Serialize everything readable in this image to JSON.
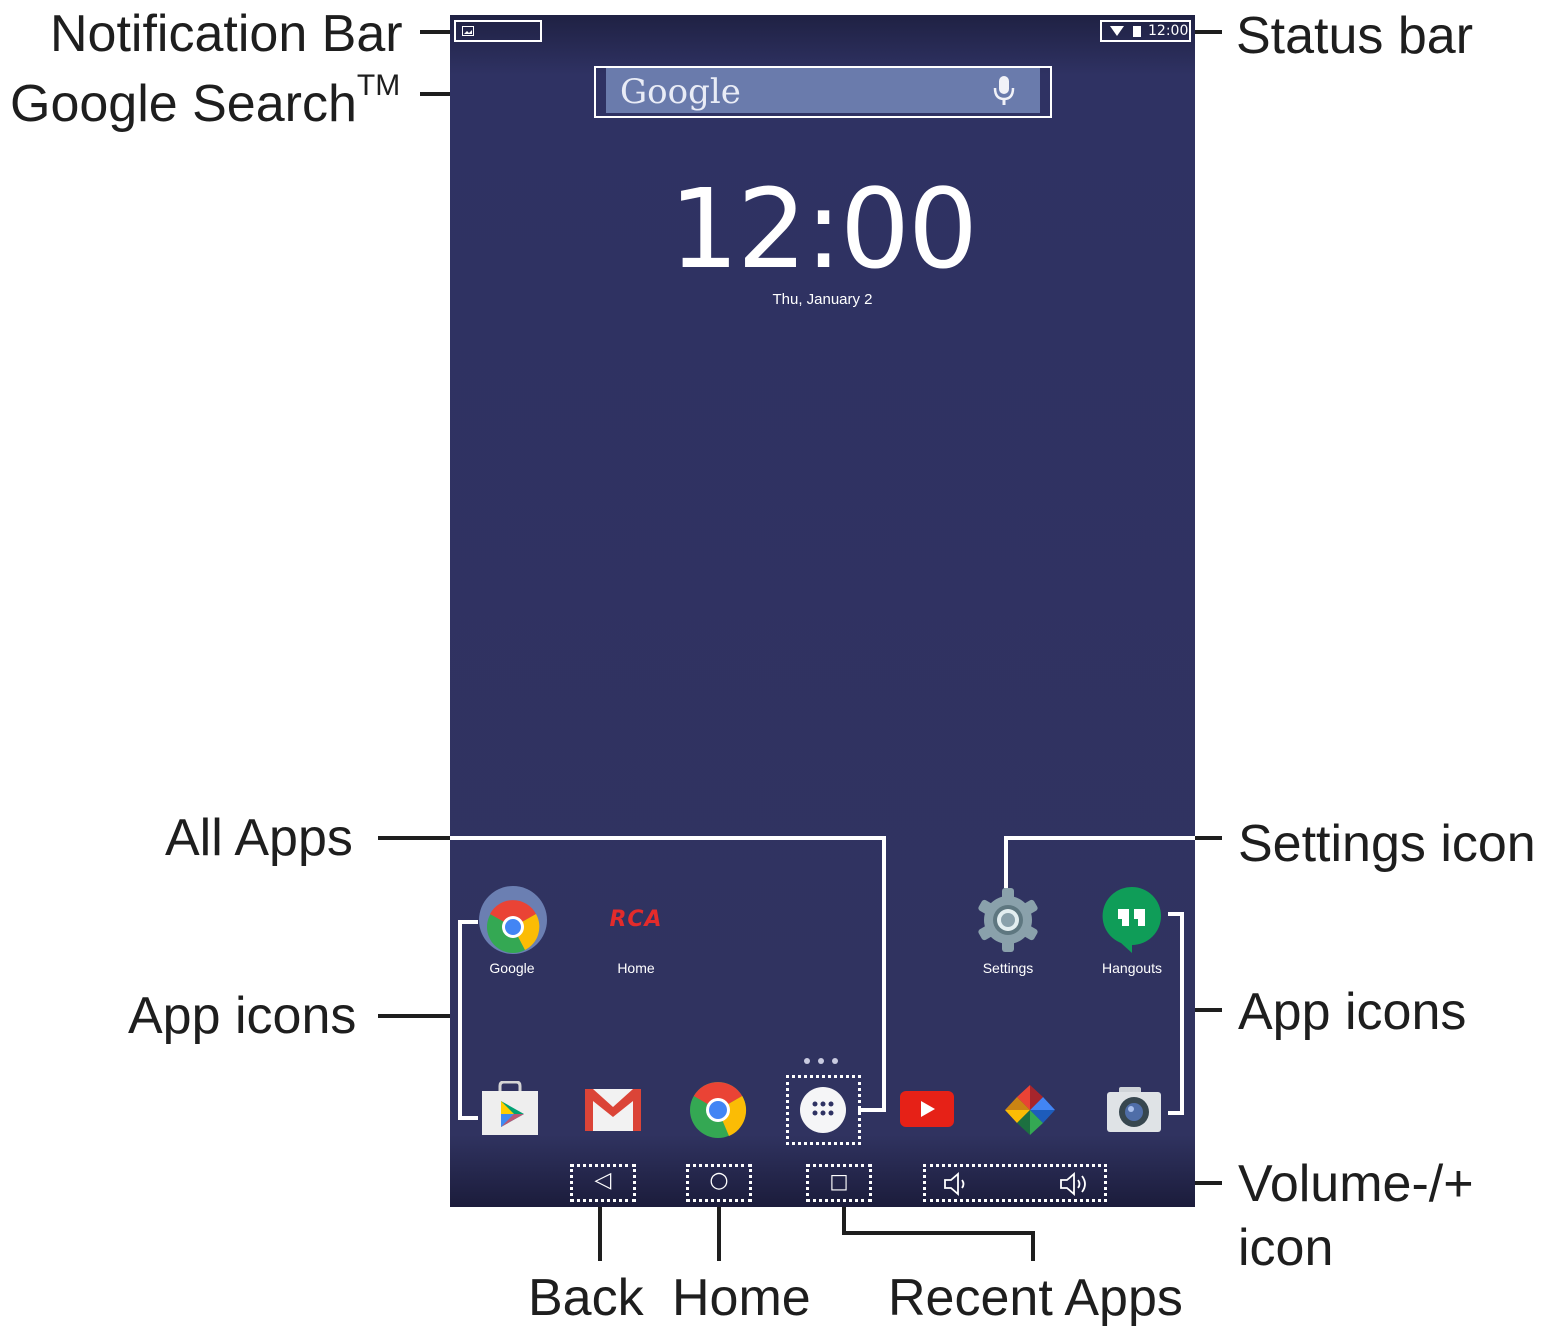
{
  "callouts": {
    "notification_bar": "Notification Bar",
    "google_search": "Google Search",
    "google_search_tm": "TM",
    "status_bar": "Status bar",
    "all_apps": "All Apps",
    "settings_icon": "Settings icon",
    "app_icons_left": "App icons",
    "app_icons_right": "App icons",
    "volume_line1": "Volume-/+",
    "volume_line2": "icon",
    "back": "Back",
    "home": "Home",
    "recent_apps": "Recent Apps"
  },
  "status": {
    "time": "12:00"
  },
  "search": {
    "logo": "Google"
  },
  "clock": {
    "time": "12:00",
    "date": "Thu, January 2"
  },
  "home_apps": [
    {
      "label": "Google",
      "icon": "chrome-folder-icon"
    },
    {
      "label": "Home",
      "icon": "rca-logo-icon",
      "logo_text": "RCA"
    },
    {
      "label": "Settings",
      "icon": "gear-icon"
    },
    {
      "label": "Hangouts",
      "icon": "hangouts-icon"
    }
  ],
  "dock_apps": [
    {
      "icon": "play-store-icon"
    },
    {
      "icon": "gmail-icon"
    },
    {
      "icon": "chrome-icon"
    },
    {
      "icon": "all-apps-icon"
    },
    {
      "icon": "youtube-icon"
    },
    {
      "icon": "photos-icon"
    },
    {
      "icon": "camera-icon"
    }
  ],
  "nav": {
    "back_icon": "back-triangle-icon",
    "home_icon": "home-circle-icon",
    "recent_icon": "recent-square-icon",
    "volume_down_icon": "volume-down-icon",
    "volume_up_icon": "volume-up-icon"
  },
  "colors": {
    "screen_bg": "#303360",
    "search_bar": "#6a7bac",
    "callout_text": "#1e1e1e"
  }
}
